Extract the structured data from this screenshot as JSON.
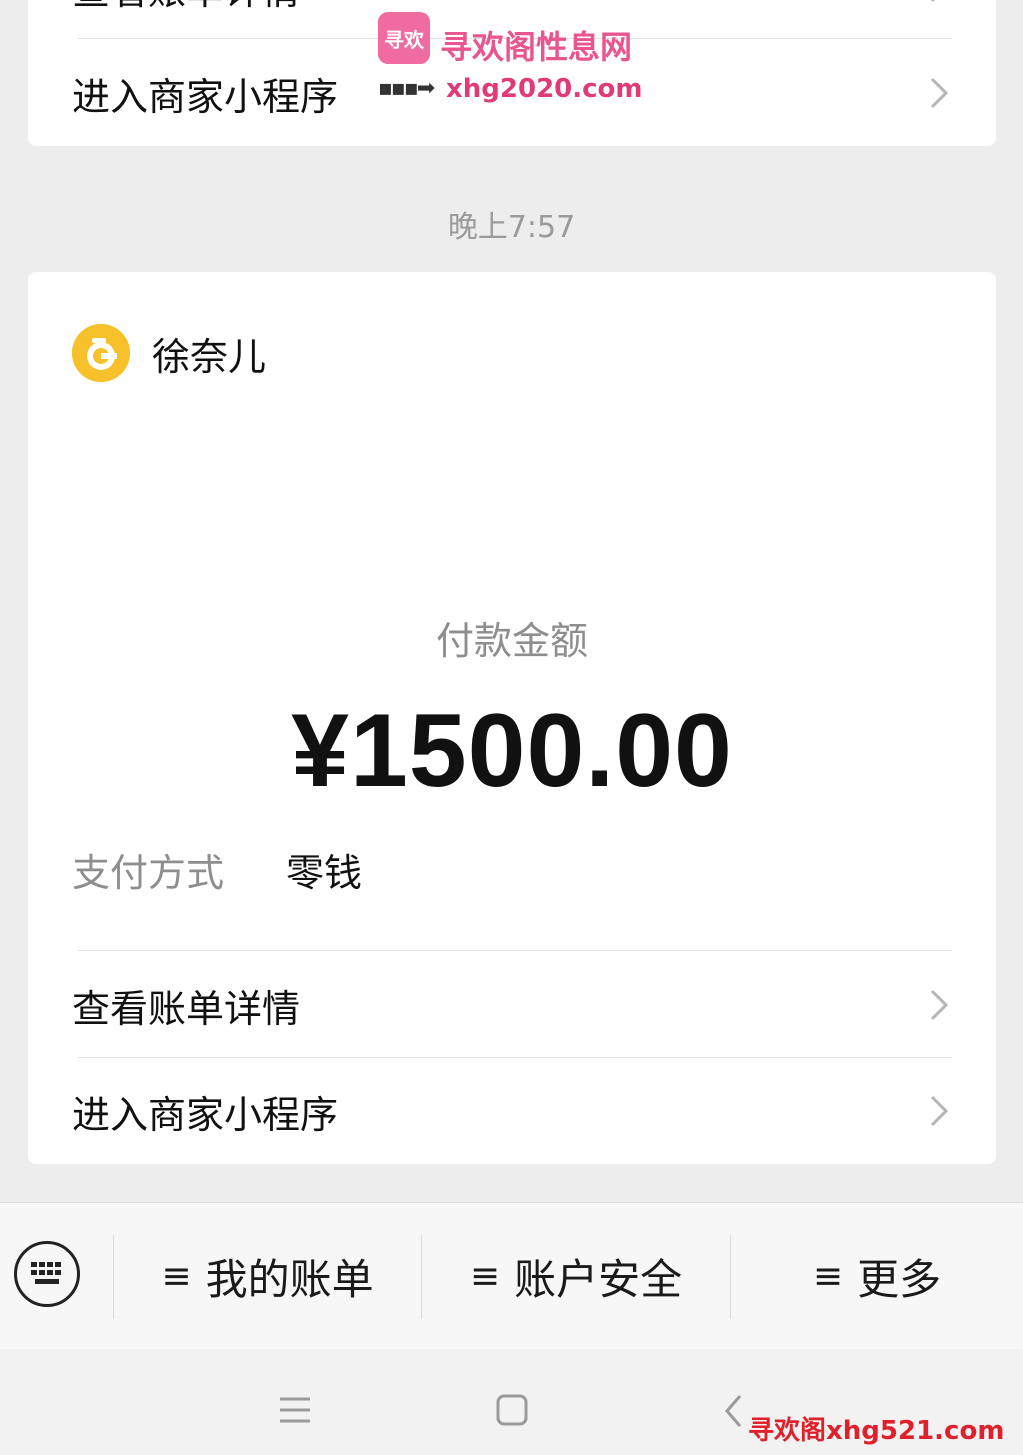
{
  "top_card": {
    "partial_row_label": "查看账单详情",
    "mini_program_label": "进入商家小程序"
  },
  "timestamp": "晚上7:57",
  "main_card": {
    "merchant_name": "徐奈儿",
    "amount_label": "付款金额",
    "amount": "¥1500.00",
    "pay_method_key": "支付方式",
    "pay_method_value": "零钱",
    "bill_details_label": "查看账单详情",
    "mini_program_label": "进入商家小程序"
  },
  "bottom_menu": {
    "items": [
      {
        "label": "我的账单"
      },
      {
        "label": "账户安全"
      },
      {
        "label": "更多"
      }
    ],
    "menu_icon_glyph": "≡"
  },
  "watermarks": {
    "top_logo": "寻欢",
    "top_title": "寻欢阁性息网",
    "top_url": "xhg2020.com",
    "bottom": "寻欢阁xhg521.com"
  },
  "colors": {
    "background": "#ededed",
    "avatar": "#f6c12a",
    "watermark": "#e8558f"
  }
}
